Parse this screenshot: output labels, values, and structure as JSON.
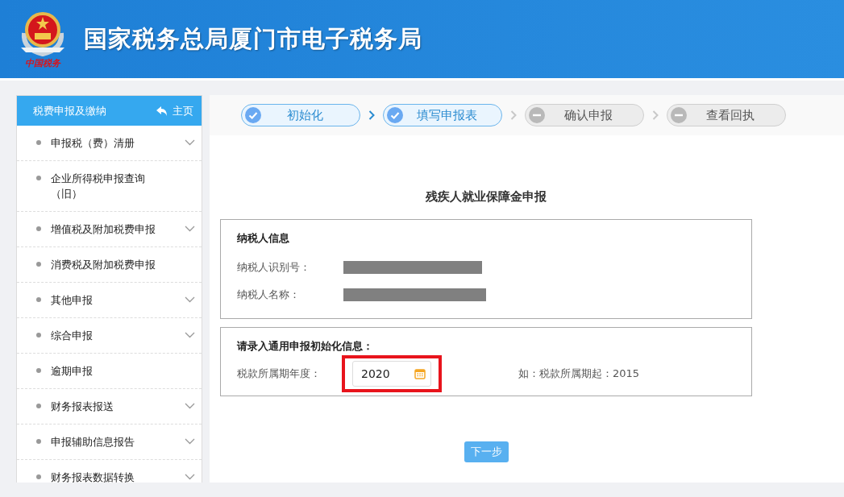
{
  "header": {
    "emblem_caption": "中国税务",
    "title": "国家税务总局厦门市电子税务局"
  },
  "sidebar": {
    "title": "税费申报及缴纳",
    "home_link": "主页",
    "items": [
      {
        "label": "申报税（费）清册",
        "expandable": true
      },
      {
        "label": "企业所得税申报查询（旧）",
        "expandable": false
      },
      {
        "label": "增值税及附加税费申报",
        "expandable": true
      },
      {
        "label": "消费税及附加税费申报",
        "expandable": false
      },
      {
        "label": "其他申报",
        "expandable": true
      },
      {
        "label": "综合申报",
        "expandable": true
      },
      {
        "label": "逾期申报",
        "expandable": false
      },
      {
        "label": "财务报表报送",
        "expandable": true
      },
      {
        "label": "申报辅助信息报告",
        "expandable": true
      },
      {
        "label": "财务报表数据转换",
        "expandable": true
      }
    ]
  },
  "steps": [
    {
      "label": "初始化",
      "completed": true
    },
    {
      "label": "填写申报表",
      "completed": true
    },
    {
      "label": "确认申报",
      "completed": false
    },
    {
      "label": "查看回执",
      "completed": false
    }
  ],
  "form": {
    "title": "残疾人就业保障金申报",
    "taxpayer": {
      "heading": "纳税人信息",
      "fields": [
        {
          "label": "纳税人识别号："
        },
        {
          "label": "纳税人名称："
        }
      ]
    },
    "init": {
      "heading": "请录入通用申报初始化信息：",
      "year_label": "税款所属期年度：",
      "year_value": "2020",
      "highlighted": true,
      "hint": "如：税款所属期起：2015"
    },
    "next_button": "下一步"
  }
}
